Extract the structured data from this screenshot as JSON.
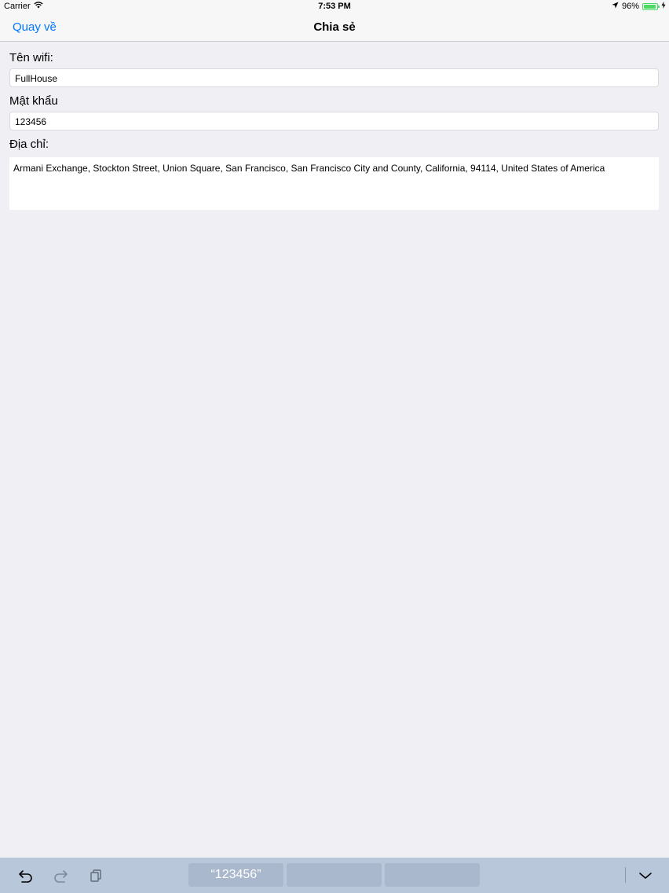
{
  "status_bar": {
    "carrier": "Carrier",
    "time": "7:53 PM",
    "battery_percent": "96%",
    "battery_level": 0.96,
    "icons": [
      "wifi-icon",
      "location-arrow-icon",
      "battery-icon",
      "charging-bolt-icon"
    ]
  },
  "nav": {
    "back_label": "Quay về",
    "title": "Chia sẻ"
  },
  "form": {
    "wifi_name_label": "Tên wifi:",
    "wifi_name_value": "FullHouse",
    "password_label": "Mật khẩu",
    "password_value": "123456",
    "address_label": "Địa chỉ:",
    "address_value": "Armani Exchange, Stockton Street, Union Square, San Francisco, San Francisco City and County, California, 94114, United States of America"
  },
  "keyboard_bar": {
    "suggestions": [
      "“123456”",
      "",
      ""
    ],
    "icons": [
      "undo-icon",
      "redo-icon",
      "paste-icon",
      "dismiss-keyboard-icon"
    ]
  },
  "colors": {
    "accent": "#0076ff",
    "background": "#efeff4",
    "battery": "#4cd964",
    "keyboard_bar": "#b8c7d9"
  }
}
